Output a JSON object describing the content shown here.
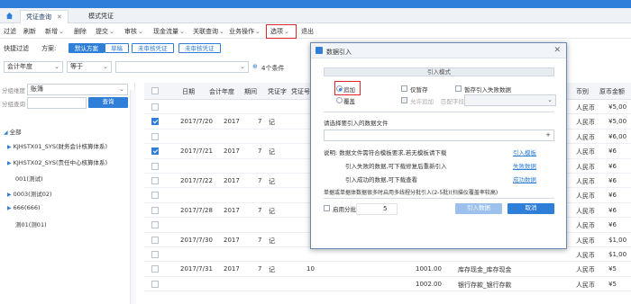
{
  "tabs": [
    {
      "label": "凭证查询"
    },
    {
      "label": "模式凭证"
    }
  ],
  "menu": [
    {
      "label": "过滤"
    },
    {
      "label": "刷新"
    },
    {
      "label": "新增"
    },
    {
      "label": "删除"
    },
    {
      "label": "提交"
    },
    {
      "label": "审核"
    },
    {
      "label": "现金流量"
    },
    {
      "label": "关联查询"
    },
    {
      "label": "业务操作"
    },
    {
      "label": "选项"
    },
    {
      "label": "退出"
    }
  ],
  "filter": {
    "quick_label": "快捷过滤",
    "scheme_label": "方案:",
    "schemes": [
      "默认方案",
      "草稿",
      "未审核凭证",
      "未审核凭证"
    ]
  },
  "condition": {
    "field": "会计年度",
    "operator": "等于",
    "value": "",
    "count": "4个条件"
  },
  "left": {
    "dim_label": "分组维度",
    "dim_value": "账簿",
    "group_label": "分组查询",
    "query_btn": "查询",
    "tree": [
      "全部",
      "KJHSTX01_SYS(财务会计核算体系)",
      "KJHSTX02_SYS(责任中心核算体系)",
      "001(测试)",
      "0003(测试02)",
      "666(666)",
      "测01(测01)"
    ]
  },
  "grid": {
    "headers": [
      "日期",
      "会计年度",
      "期间",
      "凭证字",
      "凭证号",
      "币别",
      "原币金额"
    ],
    "rows": [
      {
        "date": "",
        "year": "",
        "period": "",
        "word": "",
        "num": "",
        "currency": "人民币",
        "amount": "¥5,00"
      },
      {
        "date": "2017/7/20",
        "year": "2017",
        "period": "7",
        "word": "记",
        "num": "",
        "currency": "人民币",
        "amount": "¥5,00"
      },
      {
        "date": "",
        "year": "",
        "period": "",
        "word": "",
        "num": "",
        "currency": "人民币",
        "amount": "¥6,00"
      },
      {
        "date": "2017/7/21",
        "year": "2017",
        "period": "7",
        "word": "记",
        "num": "",
        "currency": "人民币",
        "amount": "¥6"
      },
      {
        "date": "",
        "year": "",
        "period": "",
        "word": "",
        "num": "",
        "currency": "人民币",
        "amount": "¥6"
      },
      {
        "date": "2017/7/22",
        "year": "2017",
        "period": "7",
        "word": "记",
        "num": "",
        "currency": "人民币",
        "amount": "¥6"
      },
      {
        "date": "",
        "year": "",
        "period": "",
        "word": "",
        "num": "",
        "currency": "人民币",
        "amount": "¥6"
      },
      {
        "date": "2017/7/28",
        "year": "2017",
        "period": "7",
        "word": "记",
        "num": "",
        "currency": "人民币",
        "amount": "¥6"
      },
      {
        "date": "",
        "year": "",
        "period": "",
        "word": "",
        "num": "",
        "currency": "人民币",
        "amount": "¥6"
      },
      {
        "date": "2017/7/30",
        "year": "2017",
        "period": "7",
        "word": "记",
        "num": "",
        "currency": "人民币",
        "amount": "$1,00"
      },
      {
        "date": "",
        "year": "",
        "period": "",
        "word": "",
        "num": "",
        "currency": "人民币",
        "amount": "$1,00"
      },
      {
        "date": "2017/7/31",
        "year": "2017",
        "period": "7",
        "word": "记",
        "num": "10",
        "currency": "人民币",
        "amount": "¥5"
      },
      {
        "date": "",
        "year": "",
        "period": "",
        "word": "",
        "num": "",
        "currency": "人民币",
        "amount": "¥5"
      }
    ],
    "extra": [
      {
        "code": "1001.00",
        "desc": "库存现金_库存现金"
      },
      {
        "code": "1002.00",
        "desc": "银行存款_银行存款"
      }
    ]
  },
  "modal": {
    "title": "数据引入",
    "mode_section": "引入模式",
    "opt_append": "追加",
    "opt_cover": "覆盖",
    "chk_draft": "仅暂存",
    "chk_allow": "允许追加",
    "chk_failstore": "暂存引入失败数据",
    "match_label": "匹配字段",
    "file_label": "请选择要引入的数据文件",
    "notes": [
      {
        "text": "说明: 数据文件需符合模板要求,若无模板请下载",
        "link": "引入模板"
      },
      {
        "text": "引入失败的数据,可下载修复后重新引入",
        "link": "失败数据"
      },
      {
        "text": "引入成功的数据,可下载查看",
        "link": "成功数据"
      }
    ],
    "batch_note": "单据或单据体数据很多时启用多线程分批引入(2-5批)(扫描仪覆盖率较高)",
    "batch_label": "启用分批",
    "batch_value": "5",
    "btn_import": "引入数据",
    "btn_cancel": "取消"
  }
}
